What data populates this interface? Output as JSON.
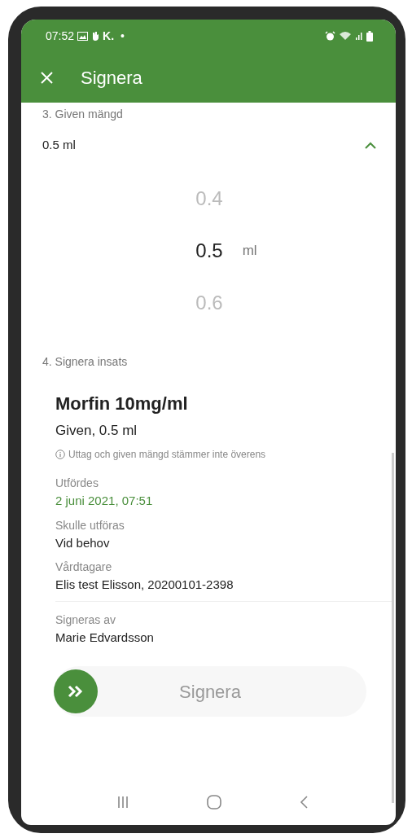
{
  "status_bar": {
    "time": "07:52",
    "notification_text": "K.",
    "notification_dot": "•"
  },
  "toolbar": {
    "title": "Signera"
  },
  "amount_section": {
    "label": "3. Given mängd",
    "value": "0.5 ml",
    "expanded": true,
    "picker": {
      "unit": "ml",
      "options": [
        {
          "value": "0.4",
          "selected": false
        },
        {
          "value": "0.5",
          "selected": true
        },
        {
          "value": "0.6",
          "selected": false
        }
      ]
    }
  },
  "sign_section": {
    "label": "4. Signera insats",
    "drug": "Morfin 10mg/ml",
    "given": "Given, 0.5 ml",
    "warning": "Uttag och given mängd stämmer inte överens",
    "fields": [
      {
        "label": "Utfördes",
        "value": "2 juni 2021, 07:51",
        "kind": "highlight"
      },
      {
        "label": "Skulle utföras",
        "value": "Vid behov",
        "kind": "plain"
      },
      {
        "label": "Vårdtagare",
        "value": "Elis test Elisson, 20200101-2398",
        "kind": "plain"
      },
      {
        "label": "Signeras av",
        "value": "Marie Edvardsson",
        "kind": "divided"
      }
    ]
  },
  "swipe_button": {
    "label": "Signera"
  }
}
